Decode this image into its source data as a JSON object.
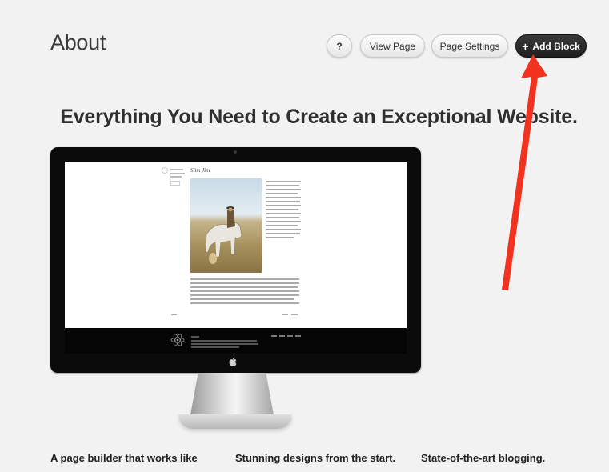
{
  "header": {
    "title": "About",
    "help_label": "?",
    "view_page_label": "View Page",
    "page_settings_label": "Page Settings",
    "add_block_label": "Add Block"
  },
  "main": {
    "headline": "Everything You Need to Create an Exceptional Website.",
    "preview": {
      "post_title": "Slim Jim"
    },
    "features": [
      "A page builder that works like",
      "Stunning designs from the start.",
      "State-of-the-art blogging."
    ]
  },
  "annotation": {
    "arrow_color": "#f0321e"
  },
  "icons": {
    "plus": "plus-icon",
    "apple": "apple-logo-icon",
    "arrow": "red-arrow-annotation"
  }
}
